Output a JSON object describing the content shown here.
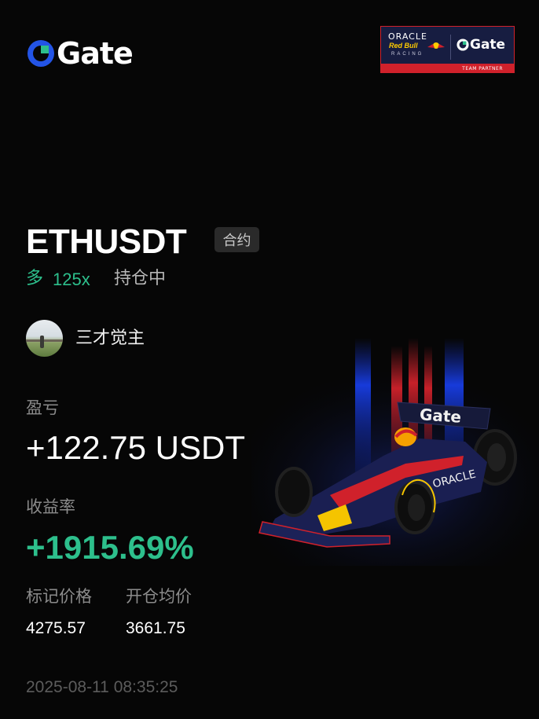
{
  "brand": {
    "name": "Gate",
    "accent_blue": "#2354e6",
    "accent_green": "#2dbf8c"
  },
  "partner_banner": {
    "oracle": "ORACLE",
    "redbull": "Red Bull",
    "racing": "RACING",
    "gate": "Gate",
    "tag": "TEAM PARTNER"
  },
  "position": {
    "pair": "ETHUSDT",
    "type_badge": "合约",
    "side": "多",
    "leverage": "125x",
    "status": "持仓中"
  },
  "user": {
    "name": "三才觉主",
    "avatar_icon": "avatar-photo"
  },
  "pnl": {
    "label": "盈亏",
    "value": "+122.75 USDT"
  },
  "roi": {
    "label": "收益率",
    "value": "+1915.69%"
  },
  "prices": {
    "mark_label": "标记价格",
    "mark_value": "4275.57",
    "entry_label": "开仓均价",
    "entry_value": "3661.75"
  },
  "timestamp": "2025-08-11 08:35:25",
  "illustration": {
    "car_wing_text": "Gate",
    "car_side_text": "ORACLE"
  }
}
